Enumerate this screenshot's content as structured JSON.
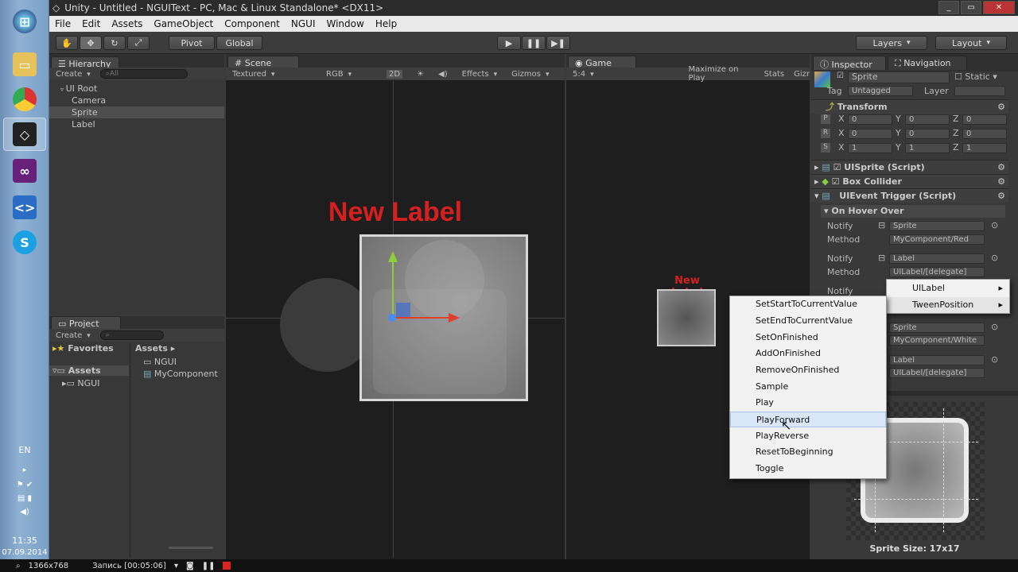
{
  "window": {
    "title": "Unity - Untitled - NGUIText - PC, Mac & Linux Standalone* <DX11>"
  },
  "menubar": [
    "File",
    "Edit",
    "Assets",
    "GameObject",
    "Component",
    "NGUI",
    "Window",
    "Help"
  ],
  "toolbar": {
    "pivot": "Pivot",
    "global": "Global",
    "layers": "Layers",
    "layout": "Layout"
  },
  "hierarchy": {
    "tab": "Hierarchy",
    "create": "Create",
    "search_placeholder": "All",
    "items": [
      "UI Root",
      "Camera",
      "Sprite",
      "Label"
    ],
    "selected": "Sprite"
  },
  "project": {
    "tab": "Project",
    "create": "Create",
    "favorites": "Favorites",
    "assets_header": "Assets",
    "tree": [
      "Assets",
      "NGUI"
    ],
    "files": [
      "NGUI",
      "MyComponent"
    ]
  },
  "scene": {
    "tab": "Scene",
    "shading": "Textured",
    "rgb": "RGB",
    "mode2d": "2D",
    "effects": "Effects",
    "gizmos": "Gizmos",
    "label_text": "New Label",
    "label_color": "#d62020"
  },
  "game": {
    "tab": "Game",
    "aspect": "5:4",
    "maximize": "Maximize on Play",
    "stats": "Stats",
    "gizmos": "Gizr",
    "label_text": "New Label"
  },
  "inspector": {
    "tab": "Inspector",
    "tab2": "Navigation",
    "object_name": "Sprite",
    "static": "Static",
    "tag_label": "Tag",
    "tag_value": "Untagged",
    "layer_label": "Layer",
    "transform": "Transform",
    "pos": {
      "x": "0",
      "y": "0",
      "z": "0"
    },
    "rot": {
      "x": "0",
      "y": "0",
      "z": "0"
    },
    "scale": {
      "x": "1",
      "y": "1",
      "z": "1"
    },
    "components": [
      "UISprite (Script)",
      "Box Collider",
      "UIEvent Trigger (Script)"
    ],
    "on_hover_over": "On Hover Over",
    "notify_label": "Notify",
    "method_label": "Method",
    "notify1": "Sprite",
    "method1": "MyComponent/Red",
    "notify2": "Label",
    "method2": "UILabel/[delegate]",
    "notify3": "Sprite",
    "method3": "MyComponent/White",
    "notify4": "Label",
    "method4": "UILabel/[delegate]",
    "sprite_size": "Sprite Size: 17x17"
  },
  "submenu": {
    "items": [
      "UILabel",
      "TweenPosition"
    ]
  },
  "context_menu": {
    "items": [
      "SetStartToCurrentValue",
      "SetEndToCurrentValue",
      "SetOnFinished",
      "AddOnFinished",
      "RemoveOnFinished",
      "Sample",
      "Play",
      "PlayForward",
      "PlayReverse",
      "ResetToBeginning",
      "Toggle"
    ],
    "highlighted": "PlayForward"
  },
  "tray": {
    "lang": "EN",
    "time": "11:35",
    "date": "07.09.2014"
  },
  "recbar": {
    "resolution": "1366x768",
    "recording": "Запись [00:05:06]"
  }
}
